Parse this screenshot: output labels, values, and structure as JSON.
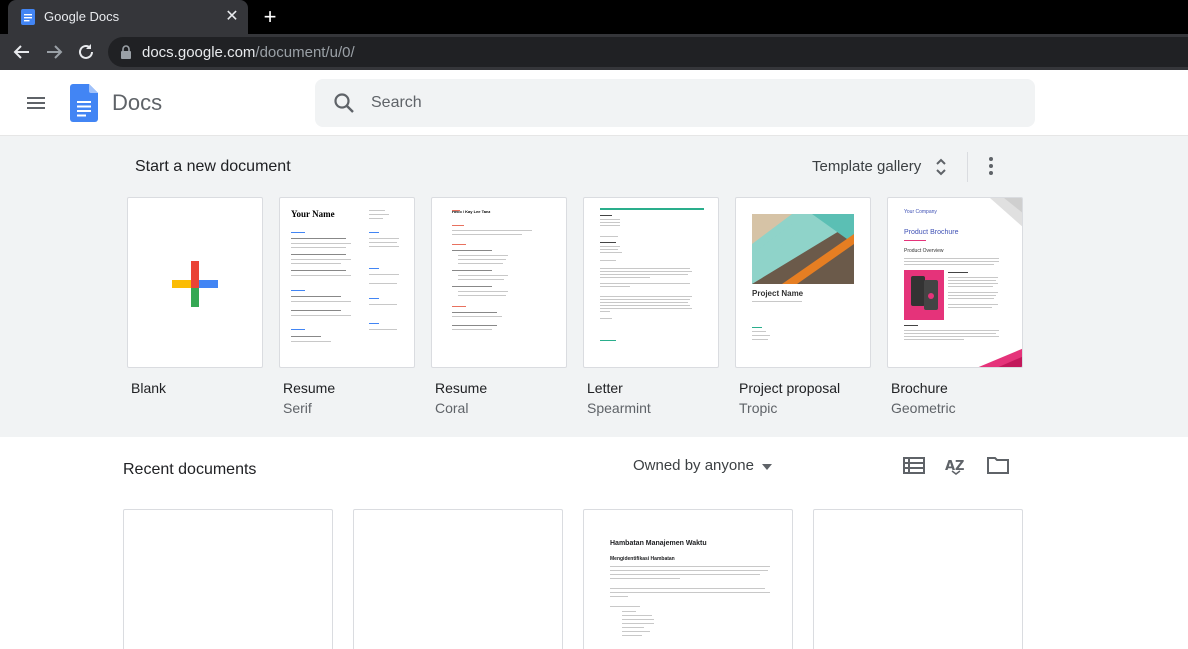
{
  "browser": {
    "tab_title": "Google Docs",
    "tab_close": "✕",
    "new_tab": "+",
    "url_host": "docs.google.com",
    "url_path": "/document/u/0/"
  },
  "header": {
    "app_title": "Docs",
    "search_placeholder": "Search"
  },
  "templates": {
    "heading": "Start a new document",
    "gallery_label": "Template gallery",
    "items": [
      {
        "name": "Blank",
        "sub": ""
      },
      {
        "name": "Resume",
        "sub": "Serif",
        "preview_title": "Your Name"
      },
      {
        "name": "Resume",
        "sub": "Coral",
        "preview_title": "Hello / Kay Lee Tanz"
      },
      {
        "name": "Letter",
        "sub": "Spearmint"
      },
      {
        "name": "Project proposal",
        "sub": "Tropic",
        "preview_title": "Project Name"
      },
      {
        "name": "Brochure",
        "sub": "Geometric",
        "preview_title": "Product Brochure",
        "preview_company": "Your Company",
        "preview_section": "Product Overview"
      }
    ]
  },
  "recent": {
    "heading": "Recent documents",
    "owned_filter": "Owned by anyone",
    "docs": [
      {
        "title": "",
        "sub": ""
      },
      {
        "title": "",
        "sub": ""
      },
      {
        "title": "Hambatan Manajemen Waktu",
        "sub": "Mengidentifikasi Hambatan"
      },
      {
        "title": "",
        "sub": ""
      }
    ]
  },
  "colors": {
    "brand_blue": "#4285f4",
    "google_red": "#ea4335",
    "google_yellow": "#fbbc04",
    "google_green": "#34a853",
    "spearmint": "#2aae8c",
    "brochure_pink": "#e5337a"
  }
}
